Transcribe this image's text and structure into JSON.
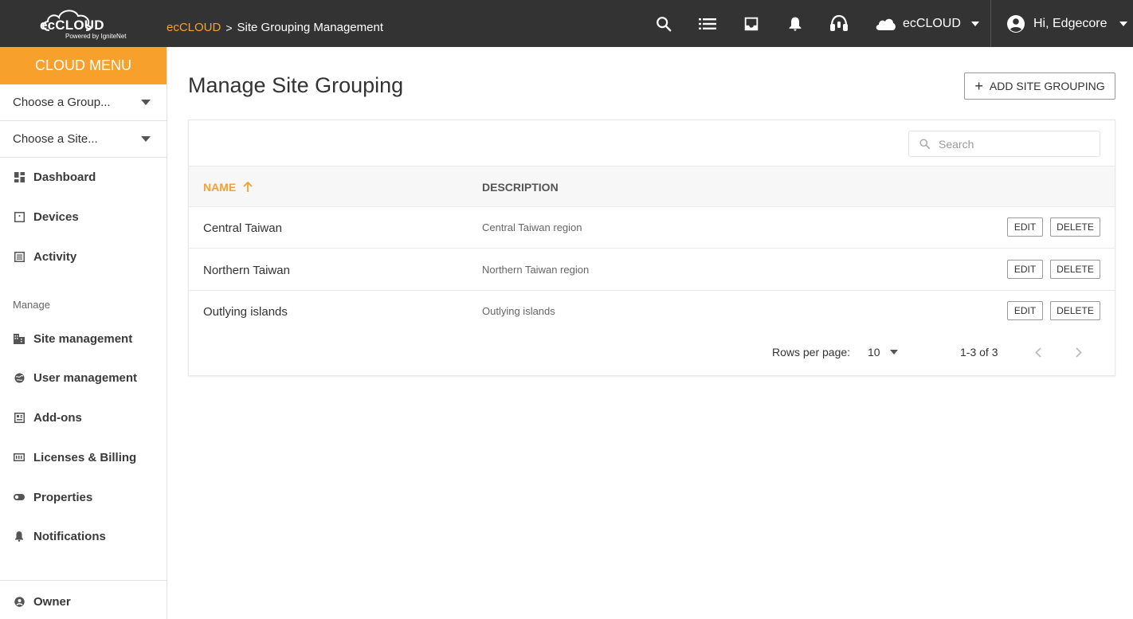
{
  "app": {
    "logo_text": "ecCLOUD",
    "powered_by": "Powered by IgniteNet"
  },
  "breadcrumb": {
    "root": "ecCLOUD",
    "separator": ">",
    "current": "Site Grouping Management"
  },
  "topbar": {
    "icons": [
      "search-icon",
      "list-icon",
      "inbox-icon",
      "bell-icon",
      "headset-icon"
    ],
    "org_label": "ecCLOUD",
    "user_label": "Hi, Edgecore"
  },
  "sidebar": {
    "menu_title": "CLOUD MENU",
    "group_chooser": "Choose a Group...",
    "site_chooser": "Choose a Site...",
    "items": [
      {
        "label": "Dashboard",
        "icon": "dashboard-icon"
      },
      {
        "label": "Devices",
        "icon": "device-icon"
      },
      {
        "label": "Activity",
        "icon": "activity-icon"
      }
    ],
    "manage_label": "Manage",
    "manage_items": [
      {
        "label": "Site management",
        "icon": "building-icon"
      },
      {
        "label": "User management",
        "icon": "globe-icon"
      },
      {
        "label": "Add-ons",
        "icon": "addons-icon"
      },
      {
        "label": "Licenses & Billing",
        "icon": "license-icon"
      },
      {
        "label": "Properties",
        "icon": "toggle-icon"
      },
      {
        "label": "Notifications",
        "icon": "bell-icon"
      }
    ],
    "owner_label": "Owner"
  },
  "main": {
    "title": "Manage Site Grouping",
    "add_button": "ADD SITE GROUPING",
    "search_placeholder": "Search",
    "columns": {
      "name": "NAME",
      "description": "DESCRIPTION"
    },
    "rows": [
      {
        "name": "Central Taiwan",
        "description": "Central Taiwan region"
      },
      {
        "name": "Northern Taiwan",
        "description": "Northern Taiwan region"
      },
      {
        "name": "Outlying islands",
        "description": "Outlying islands"
      }
    ],
    "edit_label": "EDIT",
    "delete_label": "DELETE",
    "pagination": {
      "rows_per_page_label": "Rows per page:",
      "rows_per_page": "10",
      "range": "1-3 of 3"
    }
  },
  "colors": {
    "accent": "#f7a12c",
    "topbar": "#333333"
  }
}
